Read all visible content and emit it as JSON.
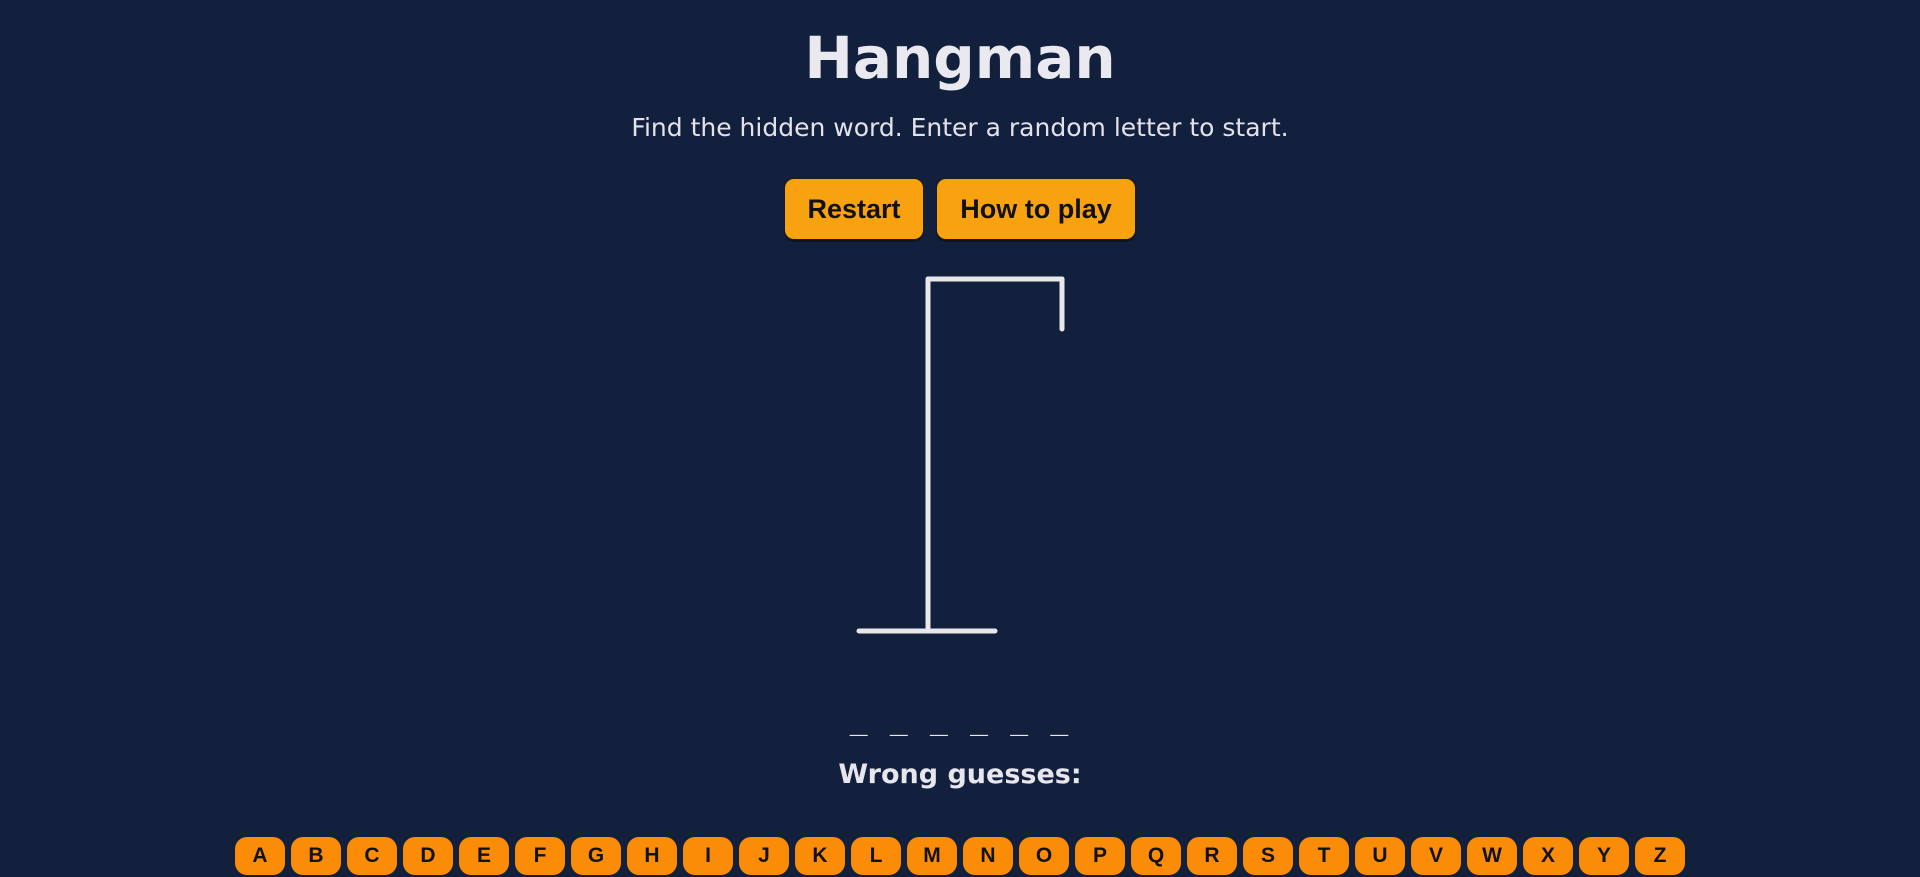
{
  "header": {
    "title": "Hangman",
    "subtitle": "Find the hidden word. Enter a random letter to start."
  },
  "controls": {
    "restart_label": "Restart",
    "how_to_play_label": "How to play"
  },
  "game": {
    "word_display": "_ _ _ _ _ _",
    "word_length": 6,
    "wrong_guesses_label": "Wrong guesses:",
    "wrong_guesses": ""
  },
  "keyboard": {
    "letters": [
      "A",
      "B",
      "C",
      "D",
      "E",
      "F",
      "G",
      "H",
      "I",
      "J",
      "K",
      "L",
      "M",
      "N",
      "O",
      "P",
      "Q",
      "R",
      "S",
      "T",
      "U",
      "V",
      "W",
      "X",
      "Y",
      "Z"
    ]
  },
  "colors": {
    "background": "#13203d",
    "button": "#f9a20f",
    "key": "#fb8c07",
    "text": "#e6e6ec",
    "gallows": "#e8e8ec"
  }
}
